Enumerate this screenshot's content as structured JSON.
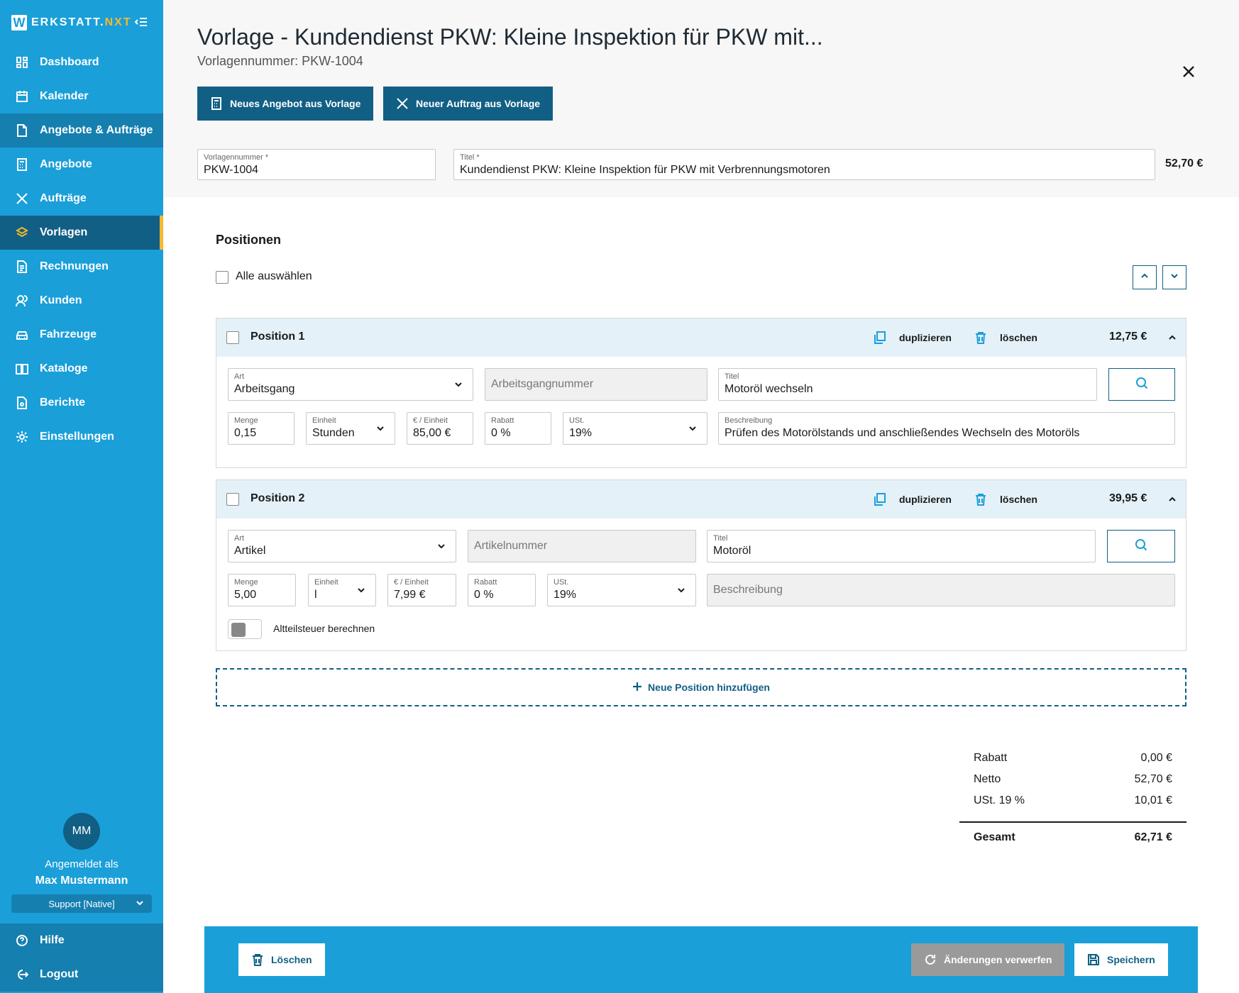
{
  "app": {
    "logo_letter": "W",
    "logo_text": "ERKSTATT.",
    "logo_suffix": "NXT"
  },
  "nav": {
    "dashboard": "Dashboard",
    "kalender": "Kalender",
    "angebote_auftraege": "Angebote & Aufträge",
    "angebote": "Angebote",
    "auftraege": "Aufträge",
    "vorlagen": "Vorlagen",
    "rechnungen": "Rechnungen",
    "kunden": "Kunden",
    "fahrzeuge": "Fahrzeuge",
    "kataloge": "Kataloge",
    "berichte": "Berichte",
    "einstellungen": "Einstellungen",
    "hilfe": "Hilfe",
    "logout": "Logout"
  },
  "user": {
    "initials": "MM",
    "logged_in_label": "Angemeldet als",
    "name": "Max Mustermann",
    "tenant": "Support [Native]"
  },
  "header": {
    "title": "Vorlage - Kundendienst PKW: Kleine Inspektion für PKW mit...",
    "subtitle": "Vorlagennummer: PKW-1004",
    "btn_angebot": "Neues Angebot aus Vorlage",
    "btn_auftrag": "Neuer Auftrag aus Vorlage",
    "vorlagennummer_label": "Vorlagennummer *",
    "vorlagennummer_value": "PKW-1004",
    "titel_label": "Titel *",
    "titel_value": "Kundendienst PKW: Kleine Inspektion für PKW mit Verbrennungsmotoren",
    "total": "52,70 €"
  },
  "positions": {
    "section_title": "Positionen",
    "select_all": "Alle auswählen",
    "duplicate_label": "duplizieren",
    "delete_label": "löschen",
    "items": [
      {
        "title": "Position 1",
        "amount": "12,75 €",
        "art_label": "Art",
        "art_value": "Arbeitsgang",
        "nummer_placeholder": "Arbeitsgangnummer",
        "titel_label": "Titel",
        "titel_value": "Motoröl wechseln",
        "menge_label": "Menge",
        "menge_value": "0,15",
        "einheit_label": "Einheit",
        "einheit_value": "Stunden",
        "preis_label": "€ / Einheit",
        "preis_value": "85,00 €",
        "rabatt_label": "Rabatt",
        "rabatt_value": "0 %",
        "ust_label": "USt.",
        "ust_value": "19%",
        "beschreibung_label": "Beschreibung",
        "beschreibung_value": "Prüfen des Motorölstands und anschließendes Wechseln des Motoröls"
      },
      {
        "title": "Position 2",
        "amount": "39,95 €",
        "art_label": "Art",
        "art_value": "Artikel",
        "nummer_placeholder": "Artikelnummer",
        "titel_label": "Titel",
        "titel_value": "Motoröl",
        "menge_label": "Menge",
        "menge_value": "5,00",
        "einheit_label": "Einheit",
        "einheit_value": "l",
        "preis_label": "€ / Einheit",
        "preis_value": "7,99 €",
        "rabatt_label": "Rabatt",
        "rabatt_value": "0 %",
        "ust_label": "USt.",
        "ust_value": "19%",
        "beschreibung_placeholder": "Beschreibung",
        "altteilsteuer_label": "Altteilsteuer berechnen"
      }
    ],
    "add_label": "Neue Position hinzufügen"
  },
  "totals": {
    "rabatt_label": "Rabatt",
    "rabatt_value": "0,00 €",
    "netto_label": "Netto",
    "netto_value": "52,70 €",
    "ust_label": "USt. 19 %",
    "ust_value": "10,01 €",
    "gesamt_label": "Gesamt",
    "gesamt_value": "62,71 €"
  },
  "actions": {
    "delete": "Löschen",
    "discard": "Änderungen verwerfen",
    "save": "Speichern"
  },
  "colors": {
    "sidebar": "#1a9fd9",
    "dark": "#115f85",
    "accent": "#f7b92b"
  }
}
